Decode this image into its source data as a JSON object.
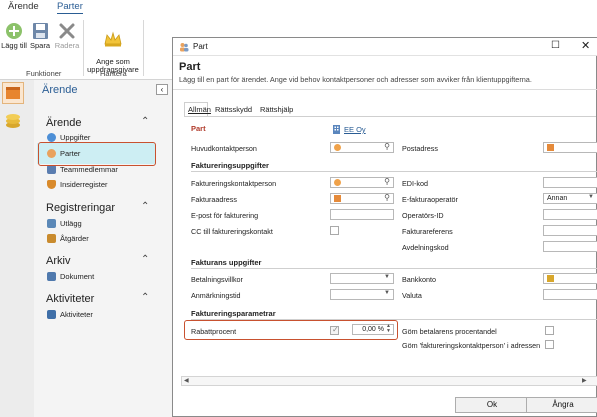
{
  "ribbon": {
    "tabs": [
      "Ärende",
      "Parter"
    ],
    "buttons": {
      "add": "Lägg till",
      "save": "Spara",
      "delete": "Radera",
      "assign": "Ange som\nuppdragsgivare"
    },
    "groups": {
      "functions": "Funktioner",
      "handle": "Hantera"
    }
  },
  "nav": {
    "title": "Ärende",
    "sections": [
      {
        "title": "Ärende",
        "items": [
          "Uppgifter",
          "Parter",
          "Teammedlemmar",
          "Insiderregister"
        ]
      },
      {
        "title": "Registreringar",
        "items": [
          "Utlägg",
          "Åtgärder"
        ]
      },
      {
        "title": "Arkiv",
        "items": [
          "Dokument"
        ]
      },
      {
        "title": "Aktiviteter",
        "items": [
          "Aktiviteter"
        ]
      }
    ]
  },
  "dialog": {
    "window_title": "Part",
    "heading": "Part",
    "description": "Lägg till en part för ärendet. Ange vid behov kontaktpersoner och adresser som avviker från klientuppgifterna.",
    "tabs": [
      "Allmän",
      "Rättsskydd",
      "Rättshjälp"
    ],
    "part": {
      "section_title": "Part",
      "party_value": "EE Oy",
      "main_contact_label": "Huvudkontaktperson",
      "postal_address_label": "Postadress"
    },
    "billing": {
      "section_title": "Faktureringsuppgifter",
      "billing_contact_label": "Faktureringskontaktperson",
      "billing_address_label": "Fakturaadress",
      "billing_email_label": "E-post för fakturering",
      "cc_label": "CC till faktureringskontakt",
      "edi_label": "EDI-kod",
      "operator_label": "E-fakturaoperatör",
      "operator_value": "Annan",
      "operator_id_label": "Operatörs-ID",
      "invoice_ref_label": "Fakturareferens",
      "department_label": "Avdelningskod"
    },
    "invoice": {
      "section_title": "Fakturans uppgifter",
      "payment_terms_label": "Betalningsvillkor",
      "remark_time_label": "Anmärkningstid",
      "bank_account_label": "Bankkonto",
      "currency_label": "Valuta"
    },
    "params": {
      "section_title": "Faktureringsparametrar",
      "discount_label": "Rabattprocent",
      "discount_value": "0,00 %",
      "hide_percent_label": "Göm betalarens procentandel",
      "hide_contact_label": "Göm 'faktureringskontaktperson' i adressen"
    },
    "ok_label": "Ok",
    "cancel_label": "Ångra"
  },
  "colors": {
    "accent": "#2a5d94",
    "highlight": "#c8512f",
    "selected": "#cdeef3"
  }
}
